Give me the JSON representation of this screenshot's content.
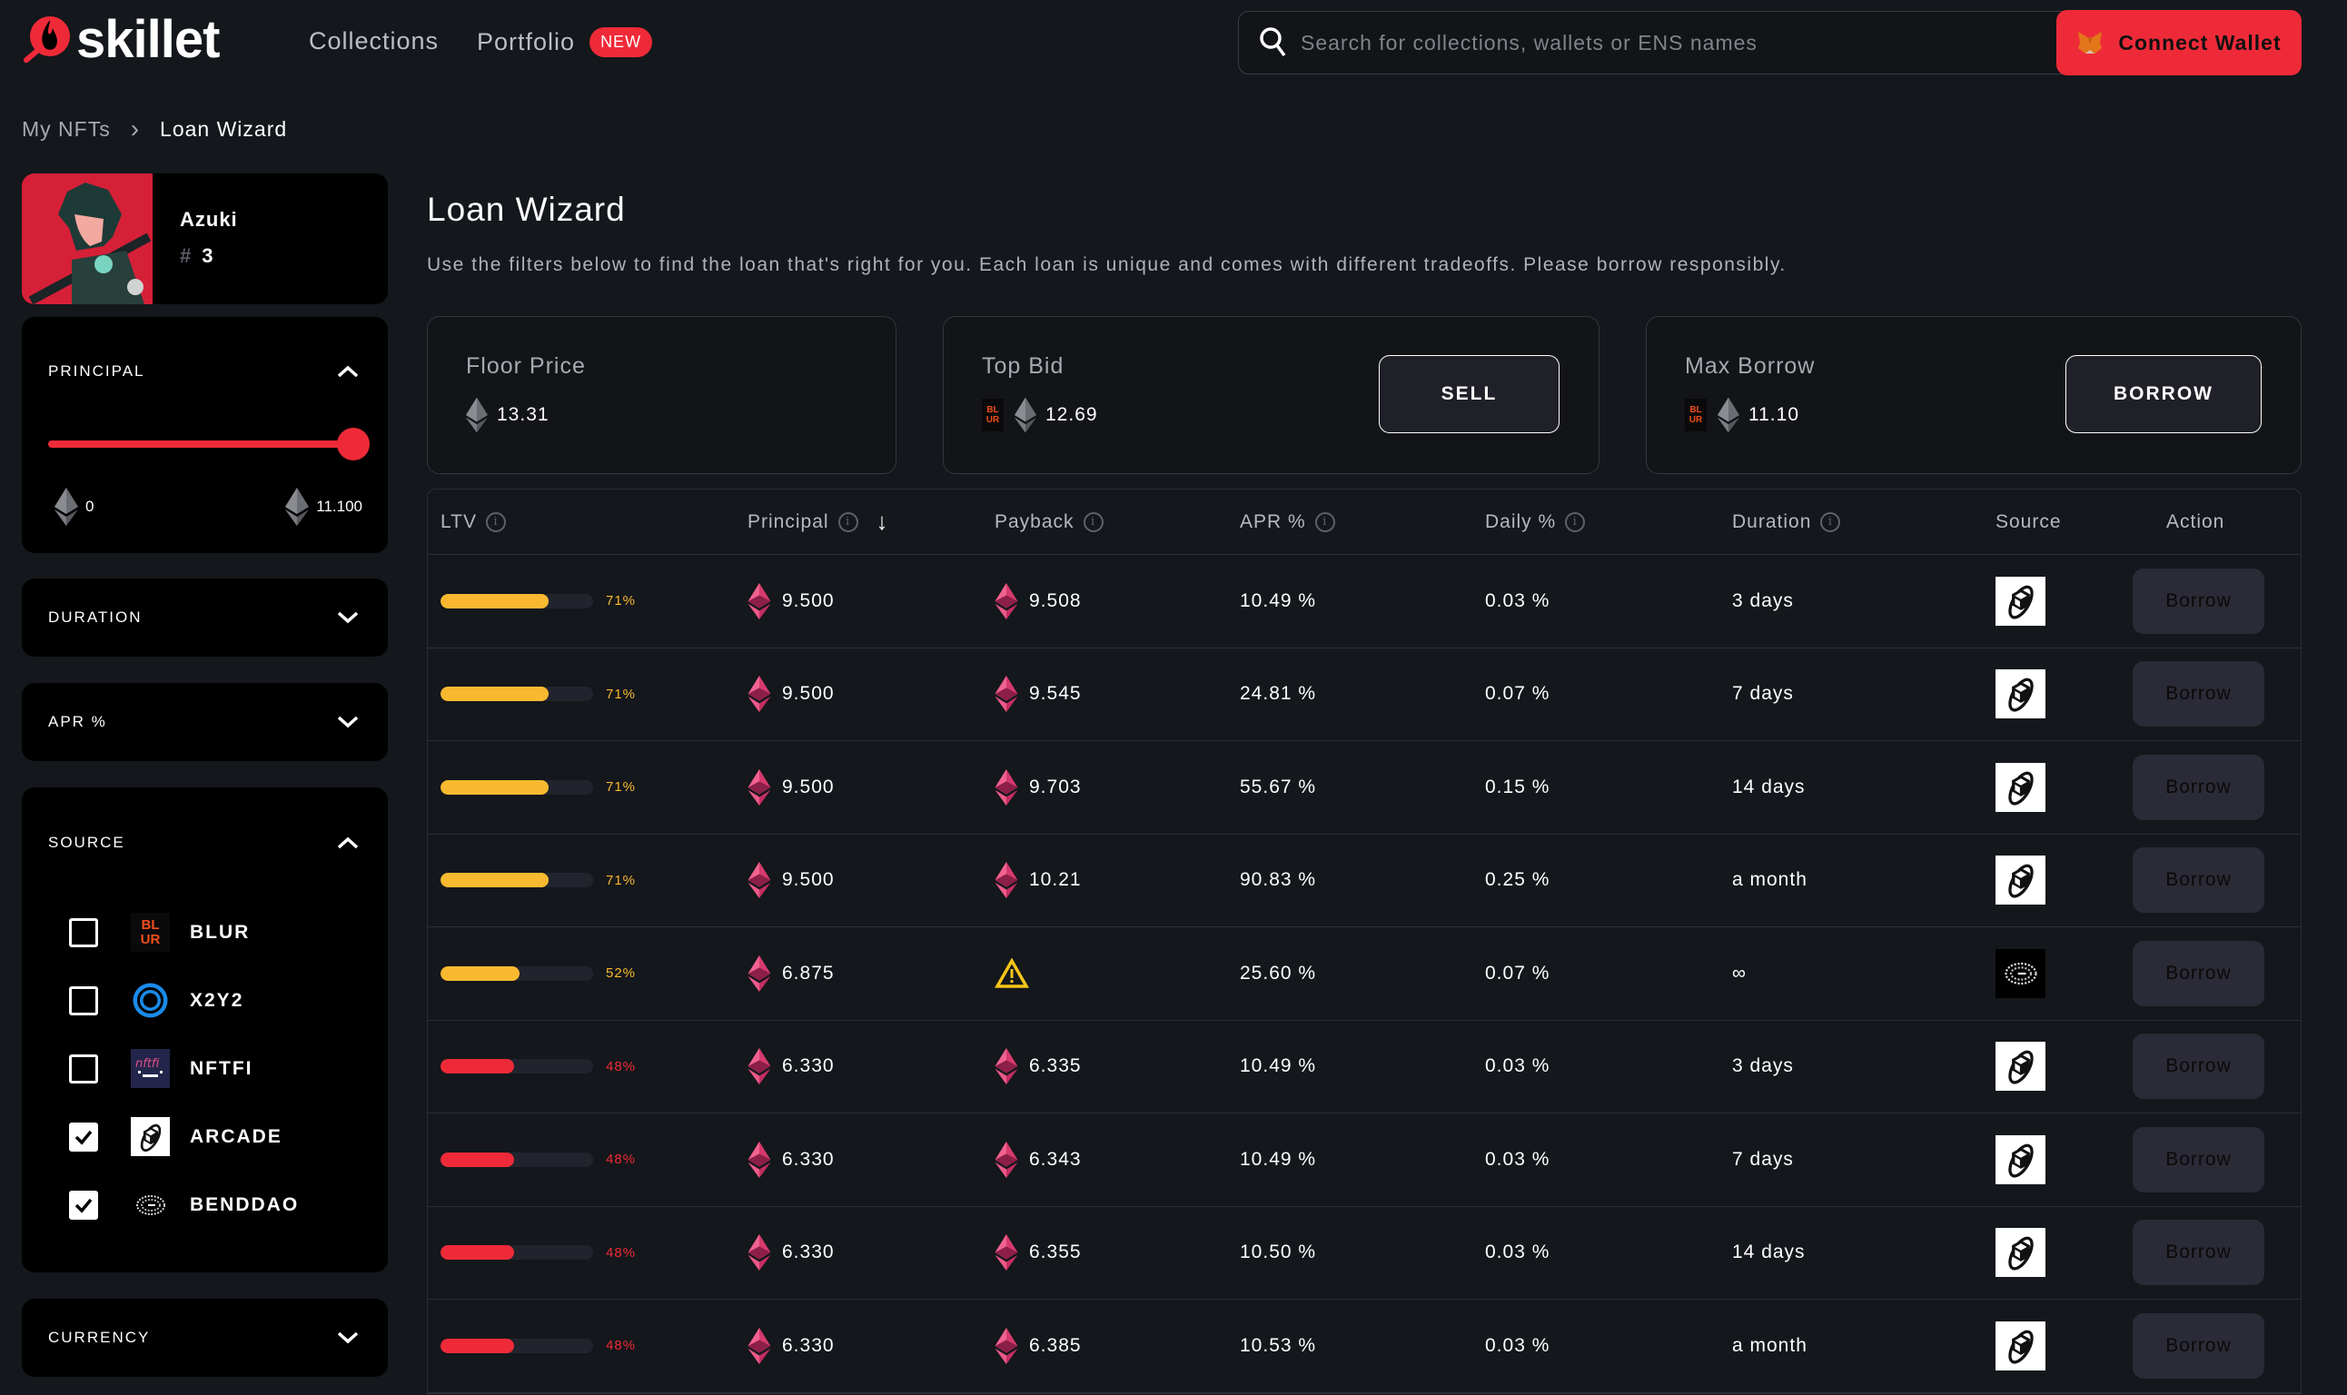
{
  "brand": {
    "name": "skillet",
    "accent": "#ef2a38"
  },
  "nav": {
    "items": [
      {
        "label": "Collections"
      },
      {
        "label": "Portfolio",
        "badge": "NEW"
      }
    ]
  },
  "search": {
    "placeholder": "Search for collections, wallets or ENS names",
    "value": ""
  },
  "connect_wallet": {
    "label": "Connect Wallet"
  },
  "breadcrumb": {
    "items": [
      "My NFTs",
      "Loan Wizard"
    ]
  },
  "nft": {
    "collection": "Azuki",
    "hash": "#",
    "token_id": "3"
  },
  "filters": {
    "principal": {
      "title": "PRINCIPAL",
      "min_label": "0",
      "max_label": "11.100",
      "value_fraction": 1.0,
      "expanded": true
    },
    "duration": {
      "title": "DURATION",
      "expanded": false
    },
    "apr": {
      "title": "APR %",
      "expanded": false
    },
    "source": {
      "title": "SOURCE",
      "expanded": true,
      "options": [
        {
          "label": "BLUR",
          "checked": false,
          "icon": "blur-logo"
        },
        {
          "label": "X2Y2",
          "checked": false,
          "icon": "x2y2-logo"
        },
        {
          "label": "NFTFI",
          "checked": false,
          "icon": "nftfi-logo"
        },
        {
          "label": "ARCADE",
          "checked": true,
          "icon": "arcade-logo"
        },
        {
          "label": "BENDDAO",
          "checked": true,
          "icon": "benddao-logo"
        }
      ]
    },
    "currency": {
      "title": "CURRENCY",
      "expanded": false
    }
  },
  "page": {
    "title": "Loan Wizard",
    "subtitle": "Use the filters below to find the loan that's right for you. Each loan is unique and comes with different tradeoffs. Please borrow responsibly."
  },
  "stats": {
    "floor_price": {
      "label": "Floor Price",
      "value": "13.31"
    },
    "top_bid": {
      "label": "Top Bid",
      "value": "12.69",
      "source": "BLUR",
      "button": "SELL"
    },
    "max_borrow": {
      "label": "Max Borrow",
      "value": "11.10",
      "source": "BLUR",
      "button": "BORROW"
    }
  },
  "table": {
    "columns": [
      "LTV",
      "Principal",
      "Payback",
      "APR %",
      "Daily %",
      "Duration",
      "Source",
      "Action"
    ],
    "sort": {
      "column": "Principal",
      "direction": "desc"
    },
    "rows": [
      {
        "ltv": "71%",
        "ltv_value": 71,
        "ltv_color": "#f8b930",
        "principal": "9.500",
        "payback": "9.508",
        "apr": "10.49 %",
        "daily": "0.03 %",
        "duration": "3 days",
        "source": "arcade",
        "action": "Borrow"
      },
      {
        "ltv": "71%",
        "ltv_value": 71,
        "ltv_color": "#f8b930",
        "principal": "9.500",
        "payback": "9.545",
        "apr": "24.81 %",
        "daily": "0.07 %",
        "duration": "7 days",
        "source": "arcade",
        "action": "Borrow"
      },
      {
        "ltv": "71%",
        "ltv_value": 71,
        "ltv_color": "#f8b930",
        "principal": "9.500",
        "payback": "9.703",
        "apr": "55.67 %",
        "daily": "0.15 %",
        "duration": "14 days",
        "source": "arcade",
        "action": "Borrow"
      },
      {
        "ltv": "71%",
        "ltv_value": 71,
        "ltv_color": "#f8b930",
        "principal": "9.500",
        "payback": "10.21",
        "apr": "90.83 %",
        "daily": "0.25 %",
        "duration": "a month",
        "source": "arcade",
        "action": "Borrow"
      },
      {
        "ltv": "52%",
        "ltv_value": 52,
        "ltv_color": "#f8b930",
        "principal": "6.875",
        "payback": null,
        "payback_warning": true,
        "apr": "25.60 %",
        "daily": "0.07 %",
        "duration": "∞",
        "source": "benddao",
        "action": "Borrow"
      },
      {
        "ltv": "48%",
        "ltv_value": 48,
        "ltv_color": "#ef2a38",
        "principal": "6.330",
        "payback": "6.335",
        "apr": "10.49 %",
        "daily": "0.03 %",
        "duration": "3 days",
        "source": "arcade",
        "action": "Borrow"
      },
      {
        "ltv": "48%",
        "ltv_value": 48,
        "ltv_color": "#ef2a38",
        "principal": "6.330",
        "payback": "6.343",
        "apr": "10.49 %",
        "daily": "0.03 %",
        "duration": "7 days",
        "source": "arcade",
        "action": "Borrow"
      },
      {
        "ltv": "48%",
        "ltv_value": 48,
        "ltv_color": "#ef2a38",
        "principal": "6.330",
        "payback": "6.355",
        "apr": "10.50 %",
        "daily": "0.03 %",
        "duration": "14 days",
        "source": "arcade",
        "action": "Borrow"
      },
      {
        "ltv": "48%",
        "ltv_value": 48,
        "ltv_color": "#ef2a38",
        "principal": "6.330",
        "payback": "6.385",
        "apr": "10.53 %",
        "daily": "0.03 %",
        "duration": "a month",
        "source": "arcade",
        "action": "Borrow"
      }
    ]
  }
}
